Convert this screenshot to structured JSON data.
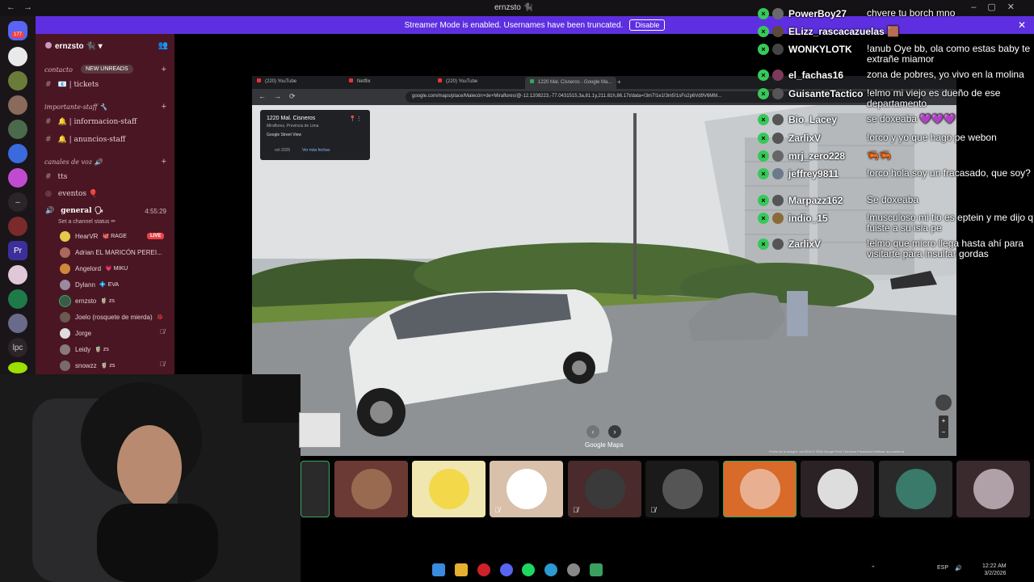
{
  "window": {
    "title": "ernzsto 🐈‍⬛"
  },
  "banner": {
    "text": "Streamer Mode is enabled. Usernames have been truncated.",
    "disable_label": "Disable"
  },
  "rail": {
    "mention_badge": "177",
    "item_lpc": "lpc",
    "item_pr": "Pr"
  },
  "sidebar": {
    "server_name": "ernzsto 🐈‍⬛",
    "categories": [
      {
        "name": "contacto",
        "badge": "NEW UNREADS",
        "channels": [
          "📧 | tickets"
        ]
      },
      {
        "name": "importante-staff 🔧",
        "channels": [
          "🔔 | informacion-staff",
          "🔔 | anuncios-staff"
        ]
      },
      {
        "name": "canales de voz 🔊",
        "channels": [
          "tts",
          "eventos 🎈"
        ]
      }
    ],
    "voice": {
      "channel": "general 🗣",
      "time": "4:55:29",
      "status_hint": "Set a channel status ✏",
      "members": [
        {
          "name": "HearVR",
          "tag": "🐙 RAGE",
          "live": "LIVE"
        },
        {
          "name": "Adrian EL MARICÓN PEREI...",
          "tag": ""
        },
        {
          "name": "Angelord",
          "tag": "💗 MIKU"
        },
        {
          "name": "Dylann",
          "tag": "💠 EVA"
        },
        {
          "name": "ernzsto",
          "tag": "🧋 zs"
        },
        {
          "name": "Joelo (rosquete de mierda)",
          "tag": "🐞"
        },
        {
          "name": "Jorge",
          "tag": ""
        },
        {
          "name": "Leidy",
          "tag": "🧋 zs"
        },
        {
          "name": "snowzz",
          "tag": "🧋 zs"
        }
      ]
    }
  },
  "browser": {
    "tabs": [
      "(220) YouTube",
      "Netflix",
      "(220) YouTube",
      "1220 Mal. Cisneros - Google Ma..."
    ],
    "url": "google.com/maps/place/Malecón+de+Miraflores/@-12.1208223,-77.0431515,3a,81.1y,211.81h,86.17t/data=!3m7!1e1!3m5!1sFo2p6Vd9V6MM...",
    "map_card": {
      "title": "1220 Mal. Cisneros",
      "subtitle": "Miraflores, Provincia de Lima",
      "provider": "Google Street View",
      "date": "oct 2025",
      "more_dates": "Ver más fechas"
    },
    "logo": "Google Maps",
    "footer": "Fecha de la imagen: oct 2025  © 2026 Google   Perú   Términos   Privacidad   Notificar un problema"
  },
  "chat": [
    {
      "user": "PowerBoy27",
      "text": "chvere tu borch mno",
      "color": "#6a6a6a"
    },
    {
      "user": "ELizz_rascacazuelas 🟫",
      "text": "",
      "color": "#5b4a3a"
    },
    {
      "user": "WONKYLOTK",
      "text": "!anub Oye bb, ola como estas baby te extrañe miamor",
      "color": "#444"
    },
    {
      "user": "el_fachas16",
      "text": "zona de pobres, yo vivo en la molina",
      "color": "#7c3a5a"
    },
    {
      "user": "GuisanteTactico",
      "text": "!elmo mi viejo es dueño de ese departamento",
      "color": "#555"
    },
    {
      "user": "Bio_Lacey",
      "text": "se doxeaba 💜💜💜",
      "color": "#555"
    },
    {
      "user": "ZarlixV",
      "text": "!orco y yo que hago pe webon",
      "color": "#555"
    },
    {
      "user": "mrj_zero228",
      "text": "🦐🦐",
      "color": "#666"
    },
    {
      "user": "jeffrey9811",
      "text": "!orco hola soy un fracasado, que soy?",
      "color": "#6a7a8a"
    },
    {
      "user": "Marpazz162",
      "text": "Se doxeaba",
      "color": "#555"
    },
    {
      "user": "indio_15",
      "text": "!musculoso mi tio es eptein y me dijo q fuiste a su isla pe",
      "color": "#8a6a3a"
    },
    {
      "user": "ZarlixV",
      "text": "!elmo que micro llega hasta ahí para visitarte para insultar gordas",
      "color": "#555"
    }
  ],
  "taskbar": {
    "time": "12:22 AM",
    "date": "3/2/2026",
    "lang": "ESP"
  }
}
